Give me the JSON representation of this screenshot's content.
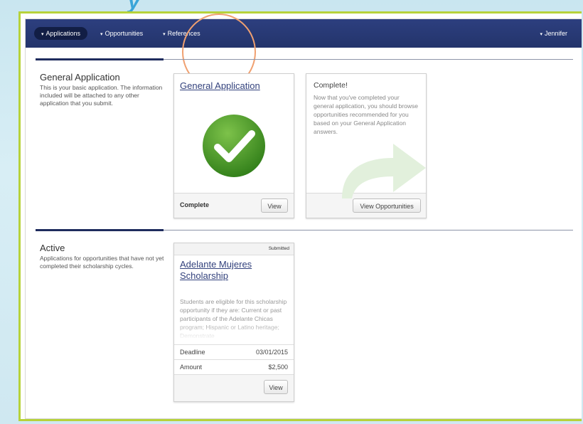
{
  "nav": {
    "applications": "Applications",
    "opportunities": "Opportunities",
    "references": "References",
    "user": "Jennifer",
    "caret": "▾"
  },
  "general": {
    "section_title": "General Application",
    "section_desc": "This is your basic application. The information included will be attached to any other application that you submit.",
    "card_link": "General Application",
    "status_label": "Complete",
    "view_button": "View"
  },
  "complete_card": {
    "title": "Complete!",
    "text": "Now that you've completed your general application, you should browse opportunities recommended for you based on your General Application answers.",
    "button": "View Opportunities"
  },
  "active": {
    "section_title": "Active",
    "section_desc": "Applications for opportunities that have not yet completed their scholarship cycles.",
    "card": {
      "badge": "Submitted",
      "link": "Adelante Mujeres Scholarship",
      "description": "Students are eligible for this scholarship opportunity if they are: Current or past participants of the Adelante Chicas program; Hispanic or Latino heritage; Demonstrate",
      "deadline_label": "Deadline",
      "deadline_value": "03/01/2015",
      "amount_label": "Amount",
      "amount_value": "$2,500",
      "view_button": "View"
    }
  },
  "colors": {
    "navbar": "#2d3f7f",
    "frame_accent": "#b7d23a",
    "link": "#33427d",
    "check_green": "#4a9a2a",
    "highlight": "#f0a070"
  }
}
